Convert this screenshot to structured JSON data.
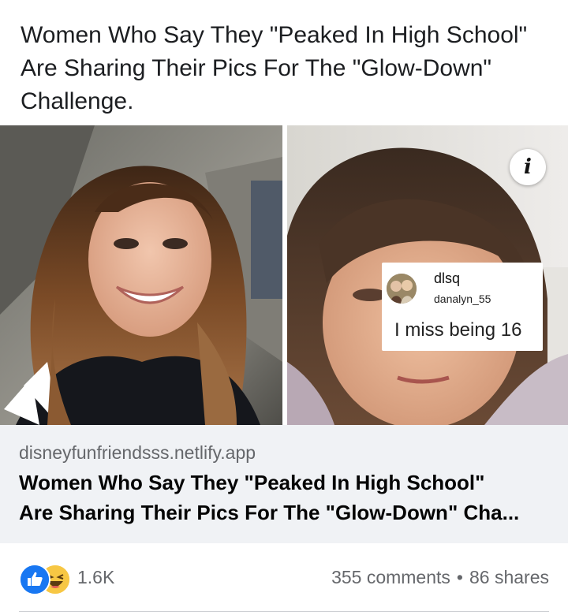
{
  "post": {
    "text_line1": "Women Who Say They \"Peaked In High School\"",
    "text_line2": "Are Sharing Their Pics For The \"Glow-Down\"",
    "text_line3": "Challenge."
  },
  "media": {
    "left_photo": "smiling-young-woman-photo",
    "right_photo": "woman-selfie-photo",
    "overlay": {
      "username": "dlsq",
      "handle": "danalyn_55",
      "caption": "I miss being 16"
    },
    "info_icon": "info-icon"
  },
  "link_preview": {
    "domain": "disneyfunfriendsss.netlify.app",
    "title_line1": "Women Who Say They \"Peaked In High School\"",
    "title_line2": "Are Sharing Their Pics For The \"Glow-Down\" Cha..."
  },
  "engagement": {
    "reaction_icons": [
      "like-icon",
      "haha-icon"
    ],
    "reaction_count": "1.6K",
    "comments": "355 comments",
    "separator": "•",
    "shares": "86 shares"
  },
  "colors": {
    "link_box_bg": "#f0f2f5",
    "secondary_text": "#65676b",
    "like_blue": "#1877f2",
    "haha_yellow": "#f7c744"
  }
}
